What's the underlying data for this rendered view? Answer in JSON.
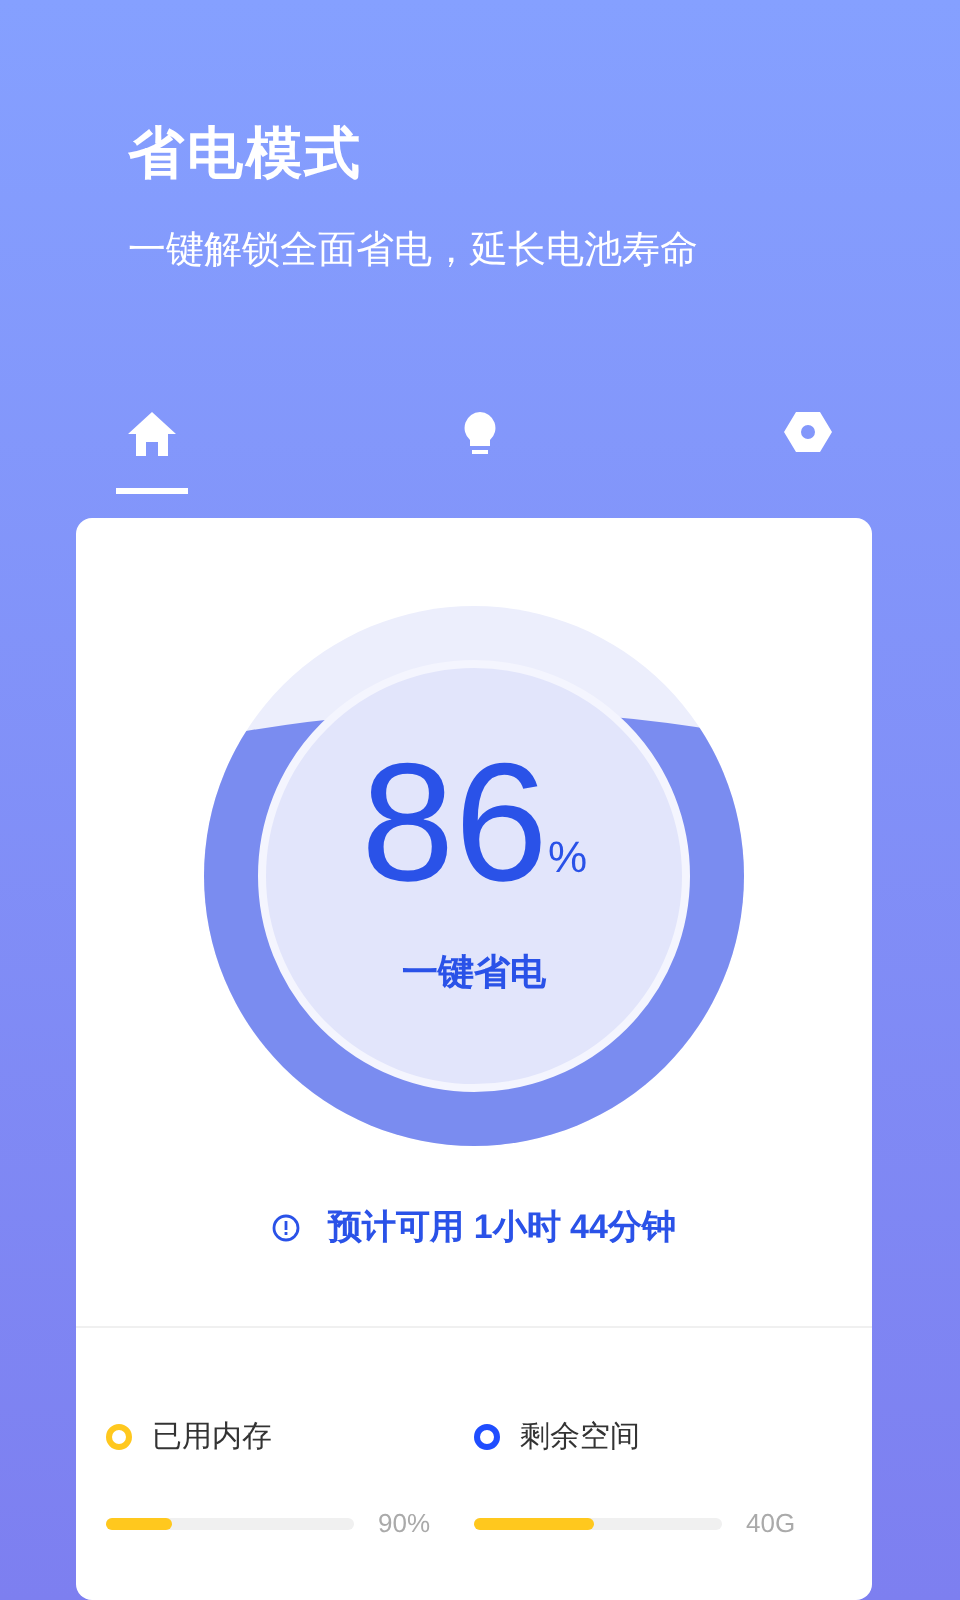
{
  "header": {
    "title": "省电模式",
    "subtitle": "一键解锁全面省电，延长电池寿命"
  },
  "tabs": [
    {
      "kind": "home",
      "selected": true
    },
    {
      "kind": "bulb",
      "selected": false
    },
    {
      "kind": "nut",
      "selected": false
    }
  ],
  "gauge": {
    "value": "86",
    "unit": "%",
    "action": "一键省电"
  },
  "estimate": "预计可用 1小时 44分钟",
  "stats": [
    {
      "label": "已用内存",
      "color": "#ffc81e",
      "level": 0.27,
      "reading": "90%"
    },
    {
      "label": "剩余空间",
      "color": "#1f4dff",
      "level": 0.48,
      "reading": "40G"
    }
  ]
}
